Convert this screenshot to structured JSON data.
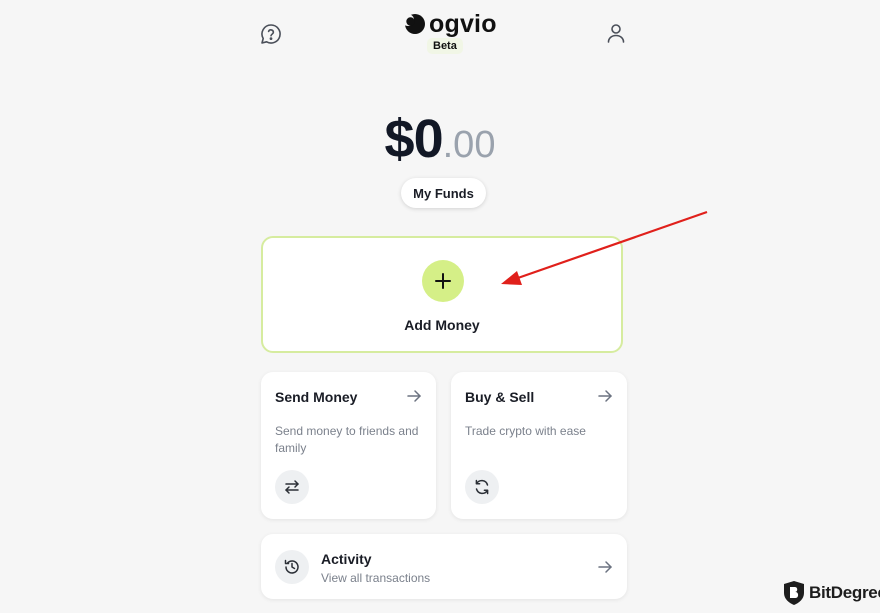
{
  "header": {
    "brand": "ogvio",
    "badge": "Beta",
    "help_icon": "help-chat-icon",
    "profile_icon": "user-icon"
  },
  "balance": {
    "whole": "$0",
    "cents": ".00",
    "funds_button": "My Funds"
  },
  "add_money": {
    "label": "Add Money",
    "icon": "plus-icon",
    "accent": "#d5ef87",
    "border": "#d6ec9f"
  },
  "cards": {
    "send": {
      "title": "Send Money",
      "description": "Send money to friends and family",
      "icon": "swap-arrows-icon"
    },
    "buy": {
      "title": "Buy & Sell",
      "description": "Trade crypto with ease",
      "icon": "refresh-icon"
    }
  },
  "activity": {
    "title": "Activity",
    "subtitle": "View all transactions",
    "icon": "history-icon"
  },
  "annotation": {
    "color": "#e0201b"
  },
  "watermark": {
    "text": "BitDegree"
  }
}
